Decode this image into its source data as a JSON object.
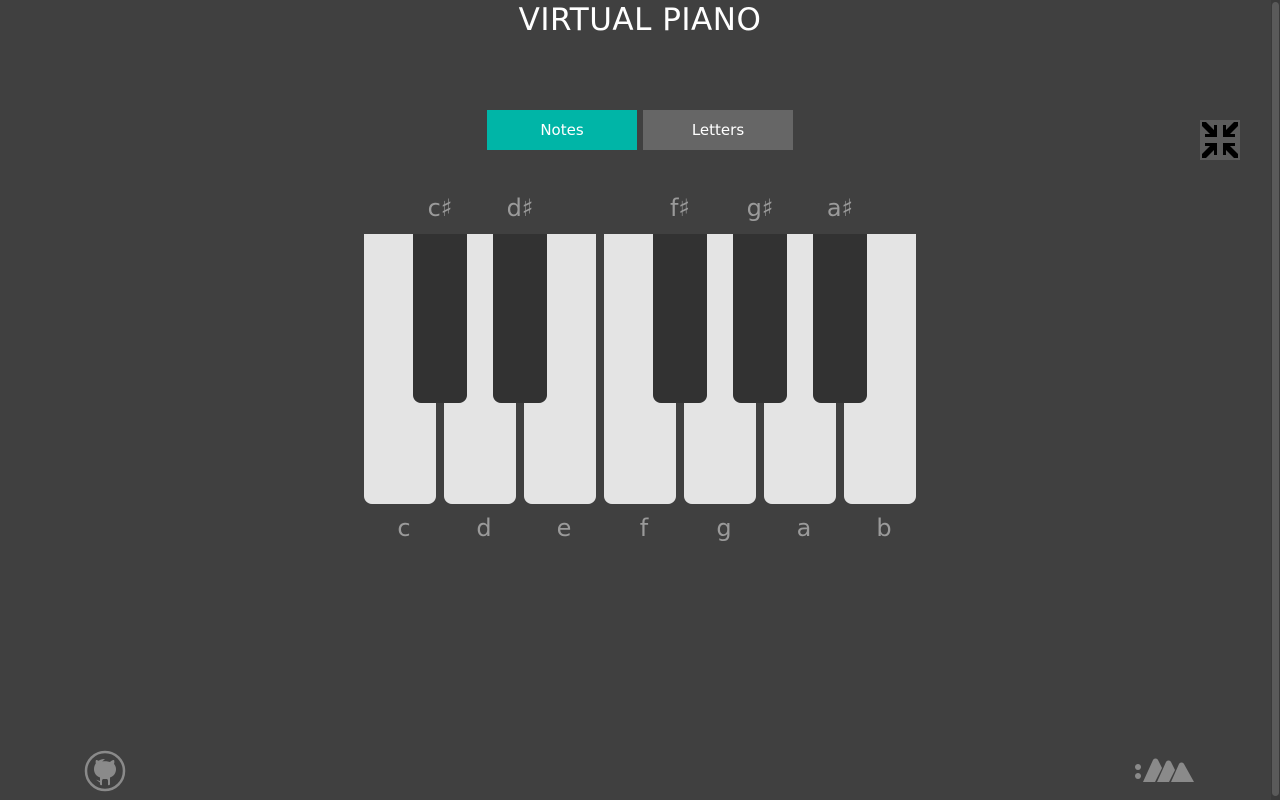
{
  "app": {
    "title": "VIRTUAL PIANO"
  },
  "mode_toggle": {
    "notes_label": "Notes",
    "letters_label": "Letters",
    "active": "Notes"
  },
  "fullscreen": {
    "icon": "exit-fullscreen-icon"
  },
  "keyboard": {
    "white_keys": [
      "c",
      "d",
      "e",
      "f",
      "g",
      "a",
      "b"
    ],
    "black_keys": [
      "c♯",
      "d♯",
      "f♯",
      "g♯",
      "a♯"
    ]
  },
  "footer": {
    "github_icon": "github-icon",
    "brand_logo": "brand-logo"
  },
  "colors": {
    "background": "#404040",
    "accent": "#00b5a7",
    "inactive_button": "#666666",
    "white_key": "#e4e4e4",
    "black_key": "#323232",
    "label": "#9a9a9a"
  }
}
